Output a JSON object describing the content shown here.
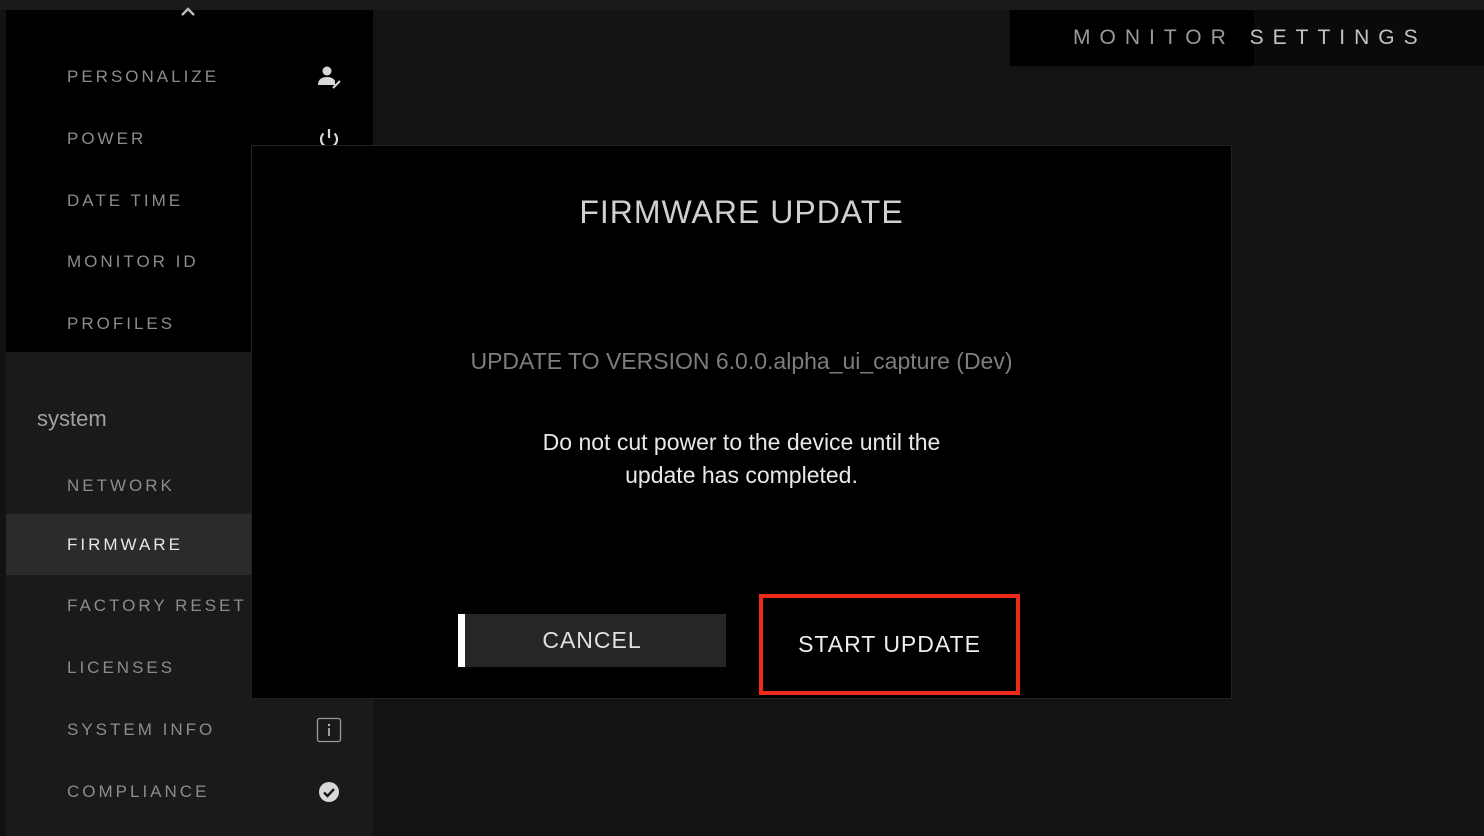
{
  "header": {
    "title_part1": "MONITOR",
    "title_part2": "SETTINGS"
  },
  "sidebar": {
    "scroll_up_icon": "chevron-up-icon",
    "top_items": [
      {
        "label": "PERSONALIZE",
        "icon": "person-edit-icon"
      },
      {
        "label": "POWER",
        "icon": "power-icon"
      },
      {
        "label": "DATE TIME"
      },
      {
        "label": "MONITOR ID"
      },
      {
        "label": "PROFILES"
      }
    ],
    "section_label": "system",
    "system_items": [
      {
        "label": "NETWORK"
      },
      {
        "label": "FIRMWARE",
        "selected": true
      },
      {
        "label": "FACTORY RESET"
      },
      {
        "label": "LICENSES"
      },
      {
        "label": "SYSTEM INFO",
        "icon": "info-icon"
      },
      {
        "label": "COMPLIANCE",
        "icon": "check-circle-icon"
      }
    ]
  },
  "dialog": {
    "title": "FIRMWARE UPDATE",
    "version_text": "UPDATE TO VERSION 6.0.0.alpha_ui_capture (Dev)",
    "warning_line1": "Do not cut power to the device until the",
    "warning_line2": "update has completed.",
    "cancel_label": "CANCEL",
    "start_label": "START UPDATE"
  },
  "colors": {
    "highlight_border": "#ee2a1b",
    "focus_bar": "#ffffff",
    "selected_item_bg": "#2b2b2b"
  }
}
